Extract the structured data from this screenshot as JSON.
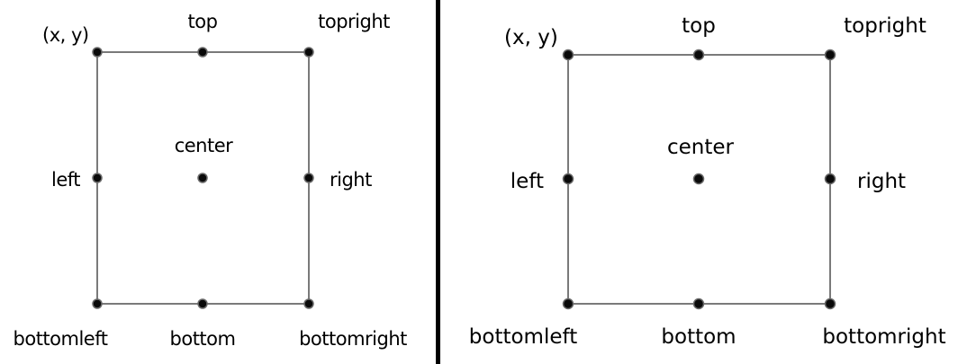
{
  "panels": [
    {
      "id": "left",
      "labels": {
        "xy": "(x, y)",
        "top": "top",
        "topright": "topright",
        "center": "center",
        "left": "left",
        "right": "right",
        "bottomleft": "bottomleft",
        "bottom": "bottom",
        "bottomright": "bottomright"
      }
    },
    {
      "id": "right",
      "labels": {
        "xy": "(x, y)",
        "top": "top",
        "topright": "topright",
        "center": "center",
        "left": "left",
        "right": "right",
        "bottomleft": "bottomleft",
        "bottom": "bottom",
        "bottomright": "bottomright"
      }
    }
  ],
  "colors": {
    "edge": "#7a7a7a",
    "point": "#0a0a0a",
    "divider": "#000000"
  }
}
